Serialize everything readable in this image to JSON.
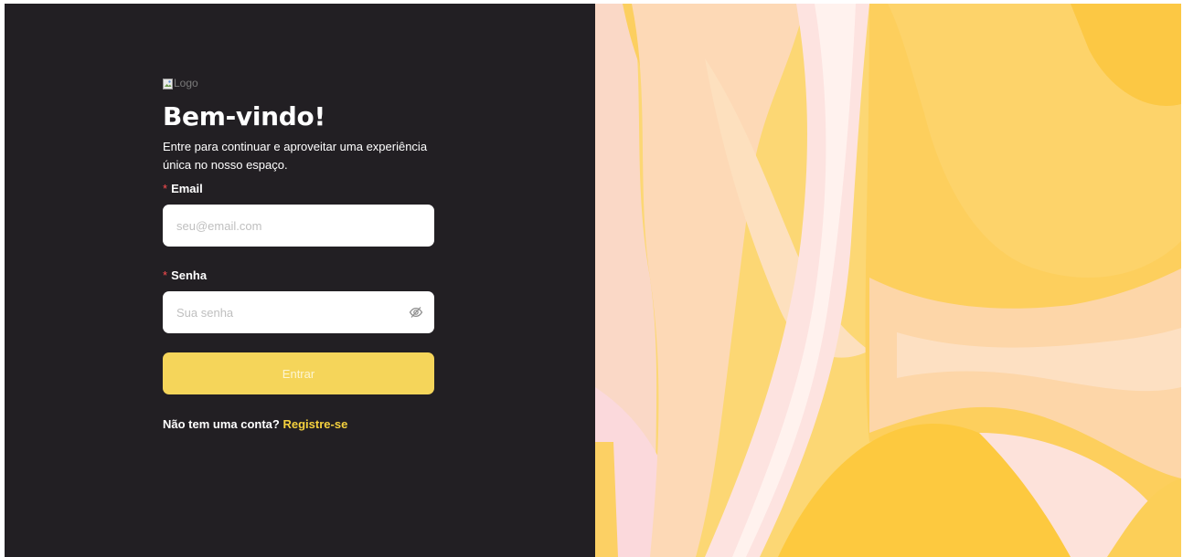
{
  "login": {
    "logo_alt": "Logo",
    "title": "Bem-vindo!",
    "subtitle": "Entre para continuar e aproveitar uma experiência única no nosso espaço.",
    "email": {
      "required_mark": "*",
      "label": "Email",
      "placeholder": "seu@email.com",
      "value": ""
    },
    "password": {
      "required_mark": "*",
      "label": "Senha",
      "placeholder": "Sua senha",
      "value": "",
      "toggle_icon": "eye-invisible-icon"
    },
    "submit_label": "Entrar",
    "register_prompt": "Não tem uma conta?",
    "register_link": "Registre-se"
  },
  "colors": {
    "left_panel_bg": "#221f23",
    "button_bg": "#f5d55a",
    "link": "#f5d13e",
    "required": "#ff4d4f"
  }
}
